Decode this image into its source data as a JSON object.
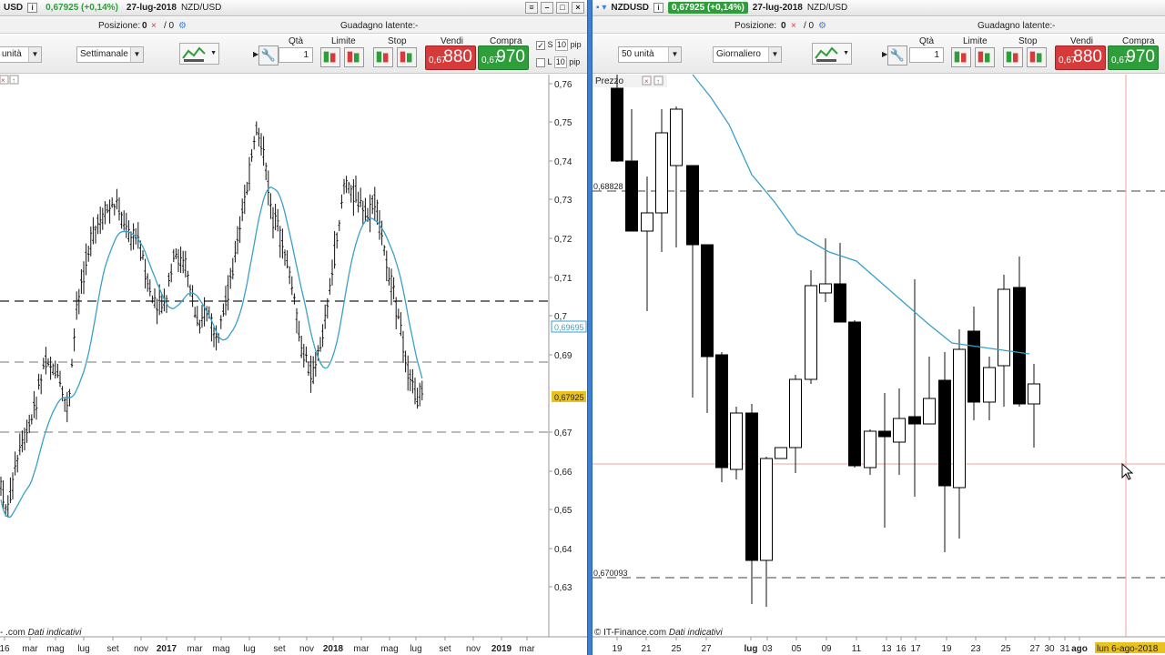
{
  "left": {
    "symbol": "USD",
    "change": "0,67925 (+0,14%)",
    "date": "27-lug-2018",
    "pair": "NZD/USD",
    "position_label": "Posizione:",
    "position_value": "0",
    "position_ratio": "/ 0",
    "latent_label": "Guadagno latente:",
    "latent_value": "-",
    "units_select": "unità",
    "period_select": "Settimanale",
    "qty_label": "Qtà",
    "qty_value": "1",
    "limit_label": "Limite",
    "stop_label": "Stop",
    "sell_label": "Vendi",
    "buy_label": "Compra",
    "sell_small": "0,67",
    "sell_big": "880",
    "buy_small": "0,67",
    "buy_big": "970",
    "s_label": "S",
    "l_label": "L",
    "pip_value": "10",
    "pip_label": "pip",
    "footer_prefix": "- .com",
    "footer_note": "Dati indicativi",
    "current_price": "0,67925",
    "ma_price": "0,69695",
    "y_ticks": [
      "0,76",
      "0,75",
      "0,74",
      "0,73",
      "0,72",
      "0,71",
      "0,7",
      "0,69",
      "0,67",
      "0,66",
      "0,65",
      "0,64",
      "0,63"
    ],
    "x_ticks": [
      "16",
      "mar",
      "mag",
      "lug",
      "set",
      "nov",
      "2017",
      "mar",
      "mag",
      "lug",
      "set",
      "nov",
      "2018",
      "mar",
      "mag",
      "lug",
      "set",
      "nov",
      "2019",
      "mar"
    ]
  },
  "right": {
    "symbol": "NZDUSD",
    "change": "0,67925 (+0,14%)",
    "date": "27-lug-2018",
    "pair": "NZD/USD",
    "position_label": "Posizione:",
    "position_value": "0",
    "position_ratio": "/ 0",
    "latent_label": "Guadagno latente:",
    "latent_value": "-",
    "units_select": "50 unità",
    "period_select": "Giornaliero",
    "qty_label": "Qtà",
    "qty_value": "1",
    "limit_label": "Limite",
    "stop_label": "Stop",
    "sell_label": "Vendi",
    "buy_label": "Compra",
    "sell_small": "0,67",
    "sell_big": "880",
    "buy_small": "0,67",
    "buy_big": "970",
    "price_tab": "Prezzo",
    "level_high": "0,68828",
    "level_low": "0,670093",
    "footer_prefix": "© IT-Finance.com",
    "footer_note": "Dati indicativi",
    "x_ticks": [
      "19",
      "21",
      "25",
      "27",
      "lug",
      "03",
      "05",
      "09",
      "11",
      "13",
      "16",
      "17",
      "19",
      "23",
      "25",
      "27",
      "30",
      "31",
      "ago"
    ],
    "crosshair_date": "lun 6-ago-2018"
  },
  "colors": {
    "accent": "#3d7fd6",
    "sell": "#d63a3a",
    "buy": "#2e9e3a",
    "ma_line": "#3aa0c8",
    "price_tag": "#e8c21e"
  },
  "icons": [
    "info-icon",
    "wrench-icon",
    "chart-type-icon",
    "limit-order-icon",
    "stop-order-icon",
    "cursor-icon"
  ]
}
